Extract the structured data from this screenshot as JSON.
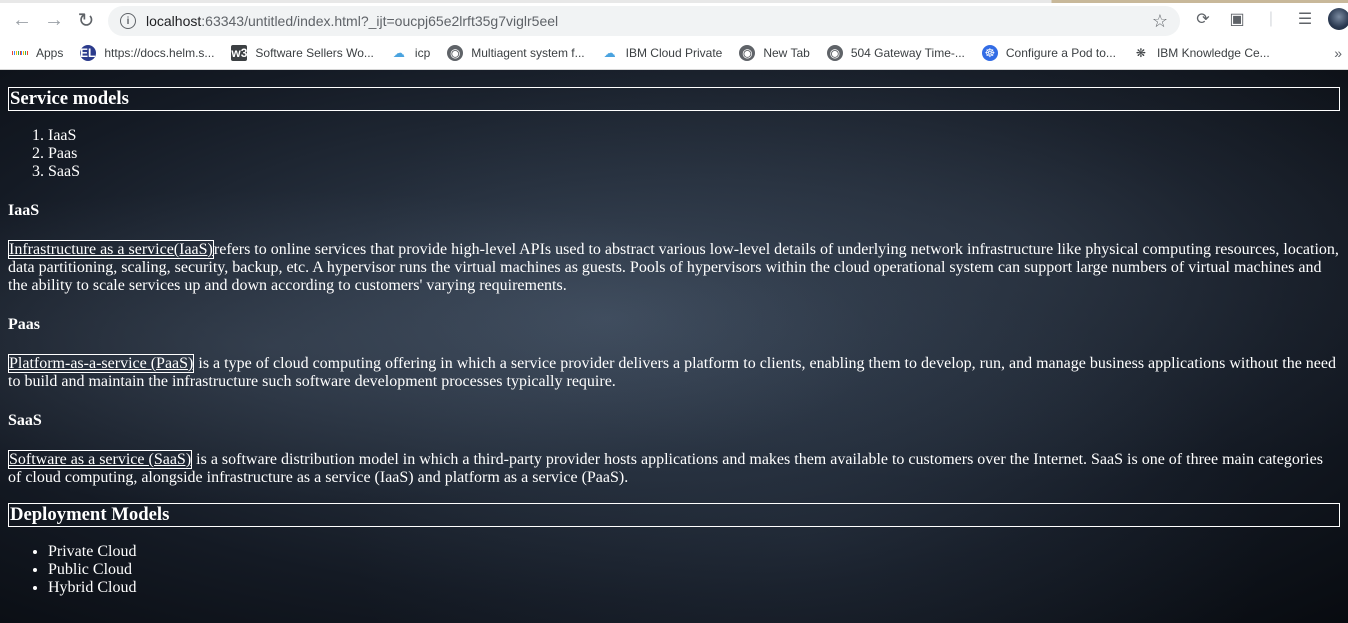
{
  "browser": {
    "url_host": "localhost",
    "url_rest": ":63343/untitled/index.html?_ijt=oucpj65e2lrft35g7viglr5eel",
    "bookmarks": [
      {
        "label": "Apps",
        "icon": "apps-grid-icon"
      },
      {
        "label": "https://docs.helm.s...",
        "icon": "helm-icon"
      },
      {
        "label": "Software Sellers Wo...",
        "icon": "w3-icon"
      },
      {
        "label": "icp",
        "icon": "cloud-icon"
      },
      {
        "label": "Multiagent system f...",
        "icon": "globe-icon"
      },
      {
        "label": "IBM Cloud Private",
        "icon": "cloud-icon"
      },
      {
        "label": "New Tab",
        "icon": "globe-icon"
      },
      {
        "label": "504 Gateway Time-...",
        "icon": "globe-icon"
      },
      {
        "label": "Configure a Pod to...",
        "icon": "kubernetes-icon"
      },
      {
        "label": "IBM Knowledge Ce...",
        "icon": "ibm-knowledge-icon"
      }
    ]
  },
  "page": {
    "service_models": {
      "heading": "Service models",
      "list": [
        "IaaS",
        "Paas",
        "SaaS"
      ]
    },
    "iaas": {
      "heading": "IaaS",
      "term": "Infrastructure as a service(IaaS)",
      "text": "refers to online services that provide high-level APIs used to abstract various low-level details of underlying network infrastructure like physical computing resources, location, data partitioning, scaling, security, backup, etc. A hypervisor runs the virtual machines as guests. Pools of hypervisors within the cloud operational system can support large numbers of virtual machines and the ability to scale services up and down according to customers' varying requirements."
    },
    "paas": {
      "heading": "Paas",
      "term": "Platform-as-a-service (PaaS)",
      "text": " is a type of cloud computing offering in which a service provider delivers a platform to clients, enabling them to develop, run, and manage business applications without the need to build and maintain the infrastructure such software development processes typically require."
    },
    "saas": {
      "heading": "SaaS",
      "term": "Software as a service (SaaS)",
      "text": " is a software distribution model in which a third-party provider hosts applications and makes them available to customers over the Internet. SaaS is one of three main categories of cloud computing, alongside infrastructure as a service (IaaS) and platform as a service (PaaS)."
    },
    "deployment_models": {
      "heading": "Deployment Models",
      "list": [
        "Private Cloud",
        "Public Cloud",
        "Hybrid Cloud"
      ]
    }
  }
}
